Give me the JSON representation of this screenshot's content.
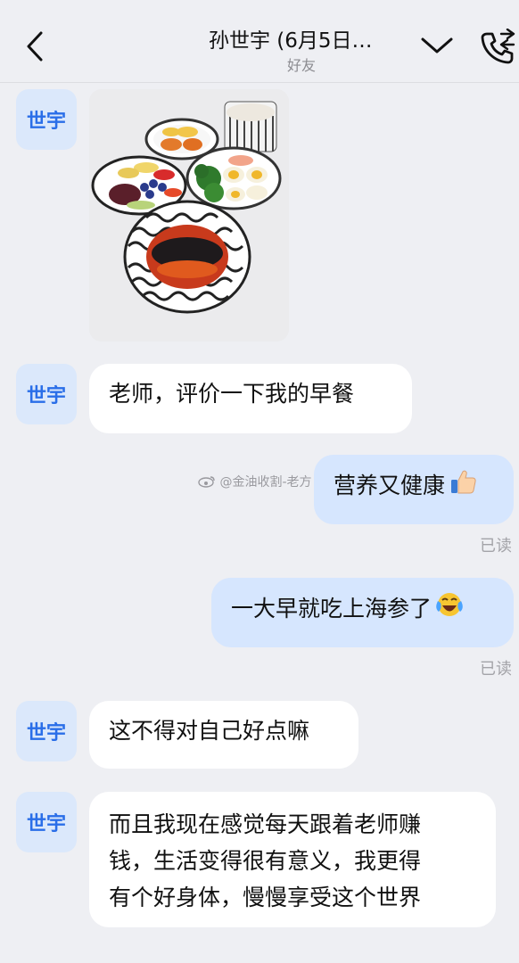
{
  "header": {
    "title": "孙世宇 (6月5日…",
    "subtitle": "好友"
  },
  "contact": {
    "avatar_text": "世宇"
  },
  "watermark": "@金油收割-老方",
  "messages": [
    {
      "side": "in",
      "type": "image",
      "image_desc": "breakfast-photo"
    },
    {
      "side": "in",
      "text": "老师，评价一下我的早餐"
    },
    {
      "side": "out",
      "text": "营养又健康",
      "emoji": "thumbs-up",
      "status": "已读"
    },
    {
      "side": "out",
      "text": "一大早就吃上海参了",
      "emoji": "laugh-crying",
      "status": "已读"
    },
    {
      "side": "in",
      "text": "这不得对自己好点嘛"
    },
    {
      "side": "in",
      "lines": [
        "而且我现在感觉每天跟着老师赚",
        "钱，生活变得很有意义，我更得",
        "有个好身体，慢慢享受这个世界"
      ]
    }
  ]
}
